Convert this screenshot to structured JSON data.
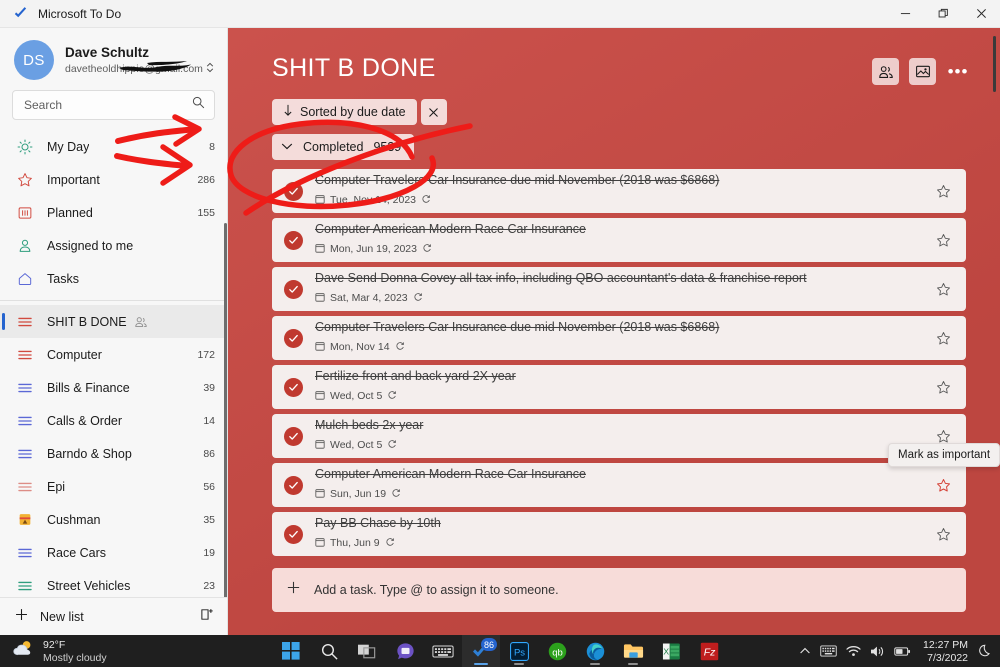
{
  "window": {
    "app_title": "Microsoft To Do",
    "logo_icon": "todo-check-logo",
    "minimize_label": "—",
    "restore_label": "❐",
    "close_label": "✕"
  },
  "account": {
    "initials": "DS",
    "name": "Dave Schultz",
    "email": "davetheoldhippie@gmail.com",
    "email_visible_prefix": "davetheoldhippi",
    "email_visible_suffix": "com",
    "chevron_icon": "chevron-updown-icon"
  },
  "search": {
    "placeholder": "Search",
    "icon": "search-icon"
  },
  "sidebar": {
    "smart_lists": [
      {
        "label": "My Day",
        "count": "8",
        "icon": "sun-icon"
      },
      {
        "label": "Important",
        "count": "286",
        "icon": "star-icon"
      },
      {
        "label": "Planned",
        "count": "155",
        "icon": "calendar-icon"
      },
      {
        "label": "Assigned to me",
        "count": "",
        "icon": "person-icon"
      },
      {
        "label": "Tasks",
        "count": "",
        "icon": "home-icon"
      }
    ],
    "custom_lists": [
      {
        "label": "SHIT B DONE",
        "count": "",
        "icon": "list-icon",
        "selected": true,
        "shared": true
      },
      {
        "label": "Computer",
        "count": "172",
        "icon": "list-icon",
        "selected": false,
        "shared": false
      },
      {
        "label": "Bills & Finance",
        "count": "39",
        "icon": "list-icon",
        "selected": false,
        "shared": false
      },
      {
        "label": "Calls & Order",
        "count": "14",
        "icon": "list-icon",
        "selected": false,
        "shared": false
      },
      {
        "label": "Barndo & Shop",
        "count": "86",
        "icon": "list-icon",
        "selected": false,
        "shared": false
      },
      {
        "label": "Epi",
        "count": "56",
        "icon": "list-icon",
        "selected": false,
        "shared": false
      },
      {
        "label": "Cushman",
        "count": "35",
        "icon": "emoji-list-icon",
        "selected": false,
        "shared": false
      },
      {
        "label": "Race Cars",
        "count": "19",
        "icon": "list-icon",
        "selected": false,
        "shared": false
      },
      {
        "label": "Street Vehicles",
        "count": "23",
        "icon": "list-icon",
        "selected": false,
        "shared": false
      }
    ],
    "new_list": {
      "label": "New list",
      "plus_icon": "plus-icon",
      "group_icon": "new-group-icon"
    }
  },
  "main": {
    "list_title": "SHIT B DONE",
    "header_icons": [
      {
        "name": "share-list-icon"
      },
      {
        "name": "background-theme-icon"
      },
      {
        "name": "more-options-icon",
        "label": "•••"
      }
    ],
    "sort_chip": {
      "label": "Sorted by due date",
      "arrow_icon": "sort-down-arrow-icon",
      "close_icon": "close-icon"
    },
    "completed_chip": {
      "label": "Completed",
      "count": "9539",
      "chevron_icon": "chevron-down-icon"
    },
    "add_task": {
      "placeholder": "Add a task. Type @ to assign it to someone.",
      "icon": "plus-icon"
    },
    "tooltip": "Mark as important",
    "tasks": [
      {
        "title": "Computer Travelers Car Insurance due mid November (2018 was $6868)",
        "date": "Tue, Nov 14, 2023",
        "repeat": true,
        "completed": true,
        "important": false
      },
      {
        "title": "Computer American Modern Race Car Insurance",
        "date": "Mon, Jun 19, 2023",
        "repeat": true,
        "completed": true,
        "important": false
      },
      {
        "title": "Dave Send Donna Covey all tax info, including QBO accountant's data & franchise report",
        "date": "Sat, Mar 4, 2023",
        "repeat": true,
        "completed": true,
        "important": false
      },
      {
        "title": "Computer Travelers Car Insurance due mid November (2018 was $6868)",
        "date": "Mon, Nov 14",
        "repeat": true,
        "completed": true,
        "important": false
      },
      {
        "title": "Fertilize front and back yard 2X year",
        "date": "Wed, Oct 5",
        "repeat": true,
        "completed": true,
        "important": false
      },
      {
        "title": "Mulch beds 2x year",
        "date": "Wed, Oct 5",
        "repeat": true,
        "completed": true,
        "important": false
      },
      {
        "title": "Computer American Modern Race Car Insurance",
        "date": "Sun, Jun 19",
        "repeat": true,
        "completed": true,
        "important": true
      },
      {
        "title": "Pay BB Chase by 10th",
        "date": "Thu, Jun 9",
        "repeat": true,
        "completed": true,
        "important": false
      }
    ]
  },
  "taskbar": {
    "weather": {
      "temperature": "92°F",
      "description": "Mostly cloudy",
      "icon": "sun-cloud-icon"
    },
    "apps": [
      {
        "name": "start-button",
        "icon": "windows-logo-icon"
      },
      {
        "name": "search-button",
        "icon": "search-icon"
      },
      {
        "name": "task-view-button",
        "icon": "task-view-icon"
      },
      {
        "name": "chat-button",
        "icon": "chat-icon"
      },
      {
        "name": "touch-keyboard-button",
        "icon": "keyboard-icon"
      },
      {
        "name": "microsoft-todo-taskbar",
        "icon": "todo-check-logo",
        "active": true,
        "badge": "86"
      },
      {
        "name": "photoshop-taskbar",
        "icon": "photoshop-icon",
        "label": "Ps"
      },
      {
        "name": "quickbooks-taskbar",
        "icon": "quickbooks-icon",
        "label": "qb"
      },
      {
        "name": "edge-taskbar",
        "icon": "edge-icon"
      },
      {
        "name": "file-explorer-taskbar",
        "icon": "folder-icon"
      },
      {
        "name": "excel-taskbar",
        "icon": "excel-icon",
        "label": "X"
      },
      {
        "name": "filezilla-taskbar",
        "icon": "filezilla-icon",
        "label": "Fz"
      }
    ],
    "tray": {
      "chevron_icon": "chevron-up-icon",
      "ime_icon": "keyboard-icon",
      "wifi_icon": "wifi-icon",
      "volume_icon": "volume-icon",
      "battery_icon": "battery-icon",
      "time": "12:27 PM",
      "date": "7/3/2022",
      "moon_icon": "do-not-disturb-moon-icon"
    }
  },
  "colors": {
    "accent_red": "#c94a44",
    "task_bg": "#f4eeed",
    "check_red": "#c0392f",
    "ink_red": "#ee1c18",
    "selection_blue": "#2564cf"
  }
}
